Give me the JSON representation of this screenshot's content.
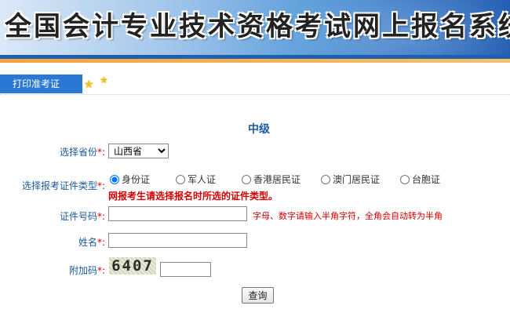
{
  "header": {
    "banner_title": "全国会计专业技术资格考试网上报名系统"
  },
  "nav": {
    "tab_label": "打印准考证"
  },
  "form": {
    "grade": "中级",
    "province_label": "选择省份",
    "province_value": "山西省",
    "cert_type_label": "选择报考证件类型",
    "cert_types": [
      "身份证",
      "军人证",
      "香港居民证",
      "澳门居民证",
      "台胞证"
    ],
    "cert_type_selected": "身份证",
    "cert_type_notice": "网报考生请选择报名时所选的证件类型。",
    "cert_no_label": "证件号码",
    "cert_no_hint": "字母、数字请输入半角字符，全角会自动转为半角",
    "name_label": "姓名",
    "code_label": "附加码",
    "captcha_text": "6407",
    "required_mark": "*:",
    "submit_label": "查询"
  },
  "colors": {
    "tab": "#2a78d4",
    "label": "#1c5a9e",
    "warning": "#d40000",
    "stripe_blue": "#1d5fb0",
    "stripe_orange": "#f6a23b"
  }
}
